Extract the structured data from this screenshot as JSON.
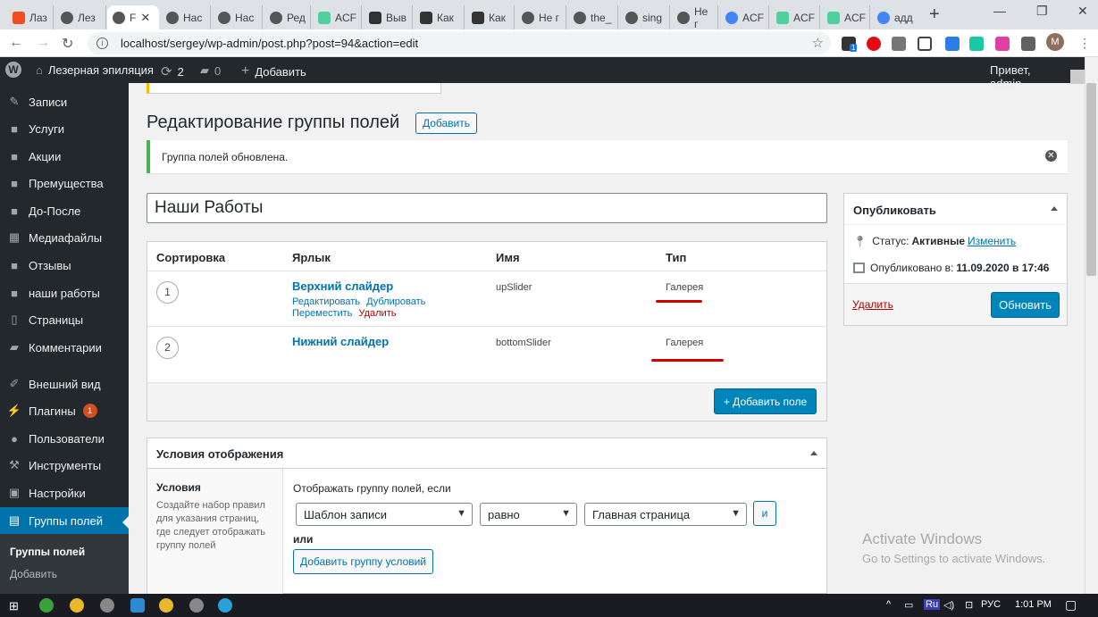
{
  "browser": {
    "tabs": [
      {
        "label": "Лаз"
      },
      {
        "label": "Лез"
      },
      {
        "label": "F"
      },
      {
        "label": "Нас"
      },
      {
        "label": "Нас"
      },
      {
        "label": "Ред"
      },
      {
        "label": "ACF"
      },
      {
        "label": "Выв"
      },
      {
        "label": "Как"
      },
      {
        "label": "Как"
      },
      {
        "label": "Не г"
      },
      {
        "label": "the_"
      },
      {
        "label": "sing"
      },
      {
        "label": "Не г"
      },
      {
        "label": "ACF"
      },
      {
        "label": "ACF"
      },
      {
        "label": "ACF"
      },
      {
        "label": "адд"
      }
    ],
    "url": "localhost/sergey/wp-admin/post.php?post=94&action=edit",
    "profile_initial": "M",
    "extension_badge": "1"
  },
  "adminbar": {
    "site_name": "Лезерная эпиляция",
    "updates_count": "2",
    "comments_count": "0",
    "new_label": "Добавить",
    "greeting": "Привет, admin"
  },
  "sidebar": {
    "items": [
      {
        "label": "Записи"
      },
      {
        "label": "Услуги"
      },
      {
        "label": "Акции"
      },
      {
        "label": "Премущества"
      },
      {
        "label": "До-После"
      },
      {
        "label": "Медиафайлы"
      },
      {
        "label": "Отзывы"
      },
      {
        "label": "наши работы"
      },
      {
        "label": "Страницы"
      },
      {
        "label": "Комментарии"
      },
      {
        "label": "Внешний вид"
      },
      {
        "label": "Плагины",
        "badge": "1"
      },
      {
        "label": "Пользователи"
      },
      {
        "label": "Инструменты"
      },
      {
        "label": "Настройки"
      },
      {
        "label": "Группы полей"
      }
    ],
    "submenu": [
      "Группы полей",
      "Добавить"
    ]
  },
  "main": {
    "page_title": "Редактирование группы полей",
    "add_new_label": "Добавить",
    "notice": "Группа полей обновлена.",
    "group_title": "Наши Работы",
    "fields": {
      "headers": [
        "Сортировка",
        "Ярлык",
        "Имя",
        "Тип"
      ],
      "rows": [
        {
          "order": "1",
          "label": "Верхний слайдер",
          "name": "upSlider",
          "type": "Галерея",
          "actions": [
            "Редактировать",
            "Дублировать",
            "Переместить",
            "Удалить"
          ]
        },
        {
          "order": "2",
          "label": "Нижний слайдер",
          "name": "bottomSlider",
          "type": "Галерея"
        }
      ],
      "add_field_label": "+ Добавить поле"
    },
    "location": {
      "title": "Условия отображения",
      "side_title": "Условия",
      "side_desc": "Создайте набор правил для указания страниц, где следует отображать группу полей",
      "rule_title": "Отображать группу полей, если",
      "param": "Шаблон записи",
      "operator": "равно",
      "value": "Главная страница",
      "and_label": "и",
      "or_label": "или",
      "add_group_label": "Добавить группу условий"
    }
  },
  "publish": {
    "title": "Опубликовать",
    "status_label": "Статус:",
    "status_value": "Активные",
    "status_edit": "Изменить",
    "published_label": "Опубликовано в:",
    "published_value": "11.09.2020 в 17:46",
    "delete_label": "Удалить",
    "update_label": "Обновить"
  },
  "watermark": {
    "title": "Activate Windows",
    "subtitle": "Go to Settings to activate Windows."
  },
  "taskbar": {
    "lang": "Ru",
    "lang2": "РУС",
    "time": "1:01 PM"
  },
  "colors": {
    "wp_blue": "#0073aa",
    "admin_bar": "#23282d",
    "notice_green": "#46b450",
    "underline_red": "#d40000"
  }
}
